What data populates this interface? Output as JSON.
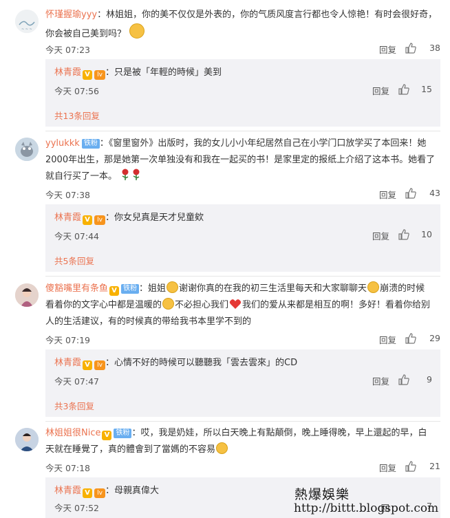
{
  "verified_mark": "V",
  "level_mark": "lv",
  "fan_badge": "铁粉",
  "comments": [
    {
      "user": "怀瑾握瑜yyy",
      "prefix": "：",
      "text": "林姐姐，你的美不仅仅是外表的，你的气质风度言行都也令人惊艳！有时会很好奇，你会被自己美到吗？",
      "time": "今天 07:23",
      "reply_label": "回复",
      "likes": "38",
      "sub": {
        "user": "林青霞",
        "text": "：只是被「年輕的時候」美到",
        "time": "今天 07:56",
        "reply_label": "回复",
        "likes": "15",
        "more": "共13条回复"
      }
    },
    {
      "user": "yylukkk",
      "prefix": "：",
      "text1": "《窗里窗外》出版时，我的女儿小小年纪居然自己在小学门口放学买了本回来！她",
      "text2": "2000年出生，那是她第一次单独没有和我在一起买的书！是家里定的报纸上介绍了这本书。她看了",
      "text3": "就自行买了一本。",
      "time": "今天 07:38",
      "reply_label": "回复",
      "likes": "43",
      "sub": {
        "user": "林青霞",
        "text": "：你女兒真是天才兒童欸",
        "time": "今天 07:44",
        "reply_label": "回复",
        "likes": "10",
        "more": "共5条回复"
      }
    },
    {
      "user": "傻豁嘴里有条鱼",
      "prefix": "：",
      "text1a": "姐姐",
      "text1b": "谢谢你真的在我的初三生活里每天和大家聊聊天",
      "text1c": "崩溃的时候",
      "text2a": "看着你的文字心中都是温暖的",
      "text2b": "不必担心我们",
      "text2c": "我们的爱从来都是相互的啊！多好！看着你给别",
      "text3": "人的生活建议，有的时候真的带给我书本里学不到的",
      "time": "今天 07:19",
      "reply_label": "回复",
      "likes": "29",
      "sub": {
        "user": "林青霞",
        "text": "：心情不好的時候可以聽聽我「雲去雲來」的CD",
        "time": "今天 07:47",
        "reply_label": "回复",
        "likes": "9",
        "more": "共3条回复"
      }
    },
    {
      "user": "林姐姐很Nice",
      "prefix": "：",
      "text1": "哎，我是奶娃，所以白天晚上有點顛倒，晚上睡得晚，早上還起的早，白",
      "text2": "天就在睡覺了，真的體會到了當媽的不容易",
      "time": "今天 07:18",
      "reply_label": "回复",
      "likes": "21",
      "sub": {
        "user": "林青霞",
        "text": "：母親真偉大",
        "time": "今天 07:52",
        "reply_label": "回",
        "likes": "7"
      }
    }
  ],
  "watermark": {
    "line1": "熱爆娛樂",
    "line2": "http://bittt.blogspot.com"
  }
}
